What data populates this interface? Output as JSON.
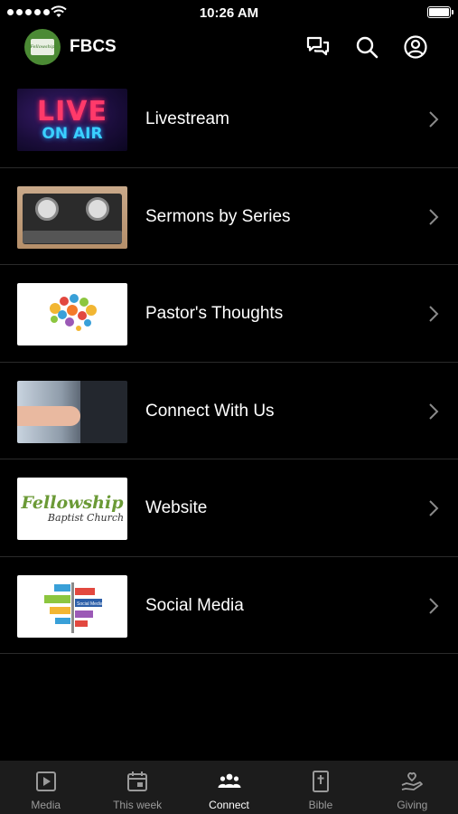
{
  "status_bar": {
    "time": "10:26 AM"
  },
  "header": {
    "logo_text": "Fellowship",
    "title": "FBCS",
    "icons": [
      "chat-icon",
      "search-icon",
      "account-icon"
    ]
  },
  "thumbnails": {
    "livestream_line1": "LIVE",
    "livestream_line2": "ON AIR",
    "website_line1": "Fellowship",
    "website_line2": "Baptist Church",
    "social_sign": "Social Media"
  },
  "menu": {
    "items": [
      {
        "label": "Livestream"
      },
      {
        "label": "Sermons by Series"
      },
      {
        "label": "Pastor's Thoughts"
      },
      {
        "label": "Connect With Us"
      },
      {
        "label": "Website"
      },
      {
        "label": "Social Media"
      }
    ]
  },
  "tabbar": {
    "tabs": [
      {
        "label": "Media",
        "icon": "play-icon"
      },
      {
        "label": "This week",
        "icon": "calendar-icon"
      },
      {
        "label": "Connect",
        "icon": "people-icon"
      },
      {
        "label": "Bible",
        "icon": "bible-icon"
      },
      {
        "label": "Giving",
        "icon": "giving-icon"
      }
    ],
    "active": "Connect"
  },
  "colors": {
    "background": "#000000",
    "tabbar": "#1c1c1c",
    "inactive_tab": "#9a9a9a",
    "divider": "#2a2a2a"
  }
}
